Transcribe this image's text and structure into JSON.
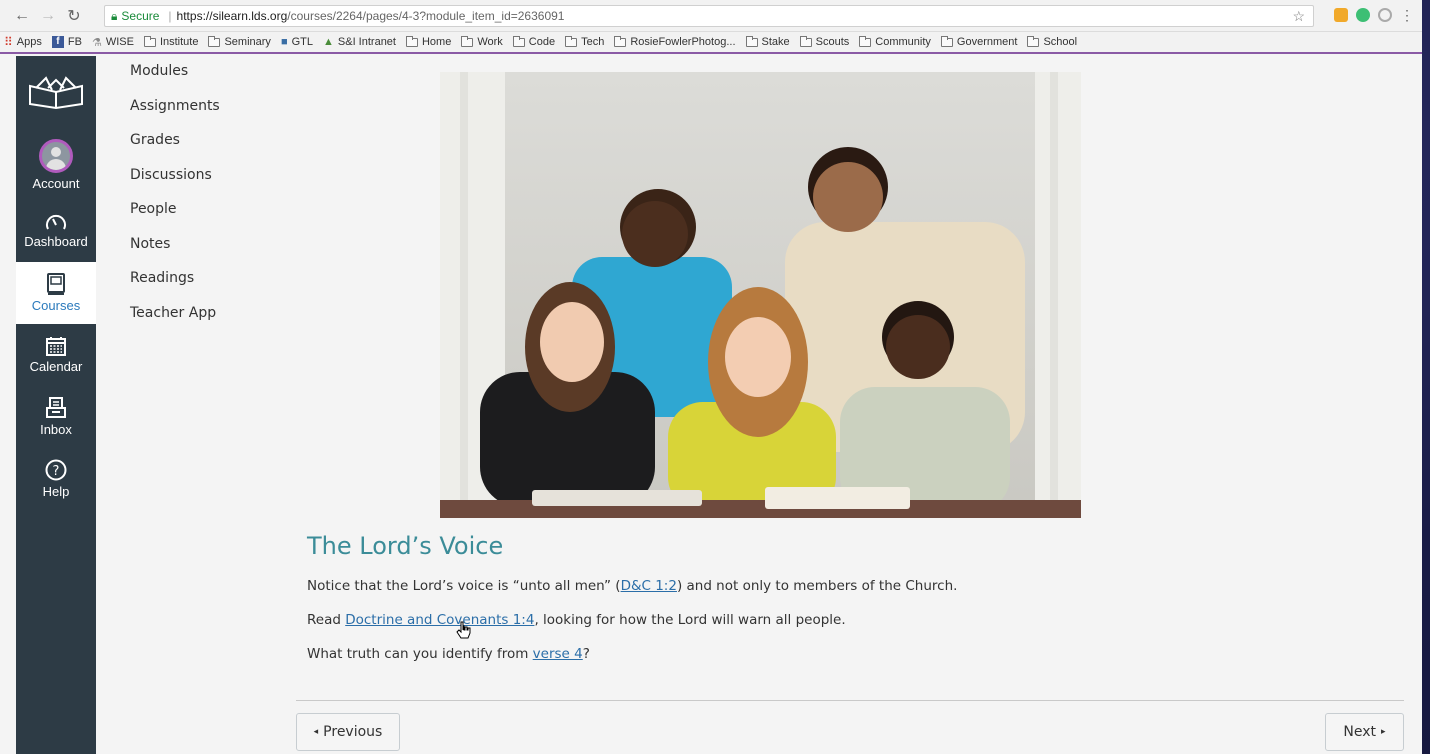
{
  "browser": {
    "secure_label": "Secure",
    "url_host": "https://silearn.lds.org",
    "url_rest": "/courses/2264/pages/4-3?module_item_id=2636091",
    "bookmarks": [
      "Apps",
      "FB",
      "WISE",
      "Institute",
      "Seminary",
      "GTL",
      "S&I Intranet",
      "Home",
      "Work",
      "Code",
      "Tech",
      "RosieFowlerPhotog...",
      "Stake",
      "Scouts",
      "Community",
      "Government",
      "School"
    ]
  },
  "global_nav": {
    "items": [
      {
        "label": "Account",
        "icon": "user-avatar-icon"
      },
      {
        "label": "Dashboard",
        "icon": "dashboard-gauge-icon"
      },
      {
        "label": "Courses",
        "icon": "courses-book-icon"
      },
      {
        "label": "Calendar",
        "icon": "calendar-icon"
      },
      {
        "label": "Inbox",
        "icon": "inbox-icon"
      },
      {
        "label": "Help",
        "icon": "help-question-icon"
      }
    ],
    "active": "Courses"
  },
  "course_nav": {
    "items": [
      "Modules",
      "Assignments",
      "Grades",
      "Discussions",
      "People",
      "Notes",
      "Readings",
      "Teacher App"
    ]
  },
  "content": {
    "title": "The Lord’s Voice",
    "p1_before": "Notice that the Lord’s voice is “unto all men” (",
    "p1_link": "D&C 1:2",
    "p1_after": ") and not only to members of the Church.",
    "p2_before": "Read ",
    "p2_link": "Doctrine and Covenants 1:4",
    "p2_after": ", looking for how the Lord will warn all people.",
    "p3_before": "What truth can you identify from ",
    "p3_link": "verse 4",
    "p3_after": "?"
  },
  "pager": {
    "previous": "Previous",
    "next": "Next"
  },
  "colors": {
    "nav_bg": "#2d3b45",
    "title": "#3b8c98",
    "link": "#2b6ea8",
    "bookmark_border": "#8a5aa5"
  }
}
